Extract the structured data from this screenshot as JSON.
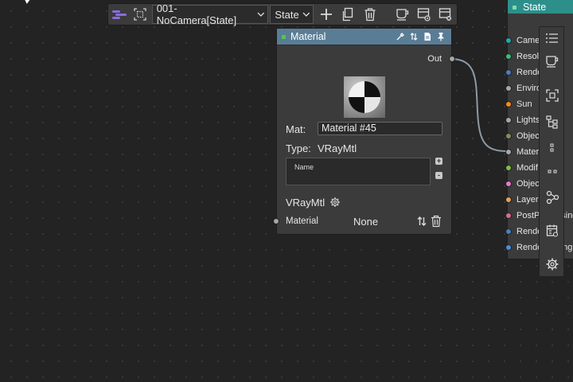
{
  "toolbar": {
    "scene_dropdown": "001-NoCamera[State]",
    "state_dropdown": "State",
    "icons": [
      "list-icon",
      "select-all-icon",
      "add-icon",
      "copy-icon",
      "delete-icon",
      "cup-icon",
      "view-state-icon",
      "clear-state-icon"
    ]
  },
  "material_node": {
    "title": "Material",
    "output_label": "Out",
    "mat_label": "Mat:",
    "mat_value": "Material #45",
    "type_label": "Type:",
    "type_value": "VRayMtl",
    "list_header": "Name",
    "plus": "+",
    "minus": "-",
    "vray_label": "VRayMtl",
    "input_label": "Material",
    "input_value": "None",
    "header_icons": [
      "eyedropper-icon",
      "swap-icon",
      "document-icon",
      "pin-icon"
    ]
  },
  "state_node": {
    "title": "State",
    "inputs": [
      {
        "label": "Came",
        "color": "#2aa5a5"
      },
      {
        "label": "Resolu",
        "color": "#3dbb74"
      },
      {
        "label": "Rende",
        "color": "#4a7fc1"
      },
      {
        "label": "Enviro",
        "color": "#a7a7a7"
      },
      {
        "label": "Sun",
        "color": "#f08c1e"
      },
      {
        "label": "Lights",
        "color": "#a7a7a7"
      },
      {
        "label": "Objec",
        "color": "#8a8a5a"
      },
      {
        "label": "Mater",
        "color": "#a7a7a7"
      },
      {
        "label": "Modif",
        "color": "#7fbf3f"
      },
      {
        "label": "Objec",
        "color": "#e879c8"
      },
      {
        "label": "Layers",
        "color": "#e8a058"
      },
      {
        "label": "PostProcessing",
        "color": "#d96c8a"
      },
      {
        "label": "Rende",
        "color": "#4a7fc1"
      },
      {
        "label": "RenderSetting(",
        "color": "#4a8fe0"
      }
    ]
  },
  "right_toolbar": {
    "icons": [
      "list-icon",
      "cup-icon",
      "frame-icon",
      "tree-icon",
      "dots-icon",
      "dots-small-icon",
      "nodes-icon",
      "calendar-icon",
      "gear-icon"
    ]
  }
}
